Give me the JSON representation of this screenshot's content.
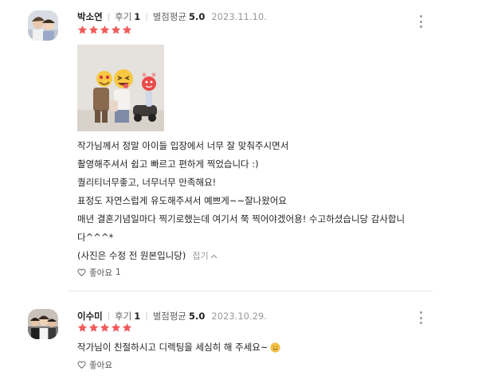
{
  "reviews": [
    {
      "name": "박소연",
      "reviews_label": "후기",
      "reviews_count": "1",
      "avg_label": "별점평균",
      "avg_value": "5.0",
      "date": "2023.11.10.",
      "rating": 5,
      "lines": [
        "작가님께서 정말 아이들 입장에서 너무 잘 맞춰주시면서",
        "촬영해주셔서 쉽고 빠르고 편하게 찍었습니다 :)",
        "퀄리티너무좋고, 너무너무 만족해요!",
        "표정도 자연스럽게 유도해주셔서 예쁘게~~잘나왔어요",
        "매년 결혼기념일마다 찍기로했는데 여기서 쭉 찍어야겠어용! 수고하셨습니당 감사합니",
        "다^^^*",
        "(사진은 수정 전 원본입니당)"
      ],
      "fold_label": "접기",
      "like_label": "좋아요",
      "like_count": "1"
    },
    {
      "name": "이수미",
      "reviews_label": "후기",
      "reviews_count": "1",
      "avg_label": "별점평균",
      "avg_value": "5.0",
      "date": "2023.10.29.",
      "rating": 5,
      "text": "작가님이 친절하시고 디렉팅을 세심히 해 주세요~",
      "like_label": "좋아요"
    }
  ],
  "colors": {
    "star": "#f15c5c",
    "emoji": "#f7c842"
  },
  "icons": [
    "more-vertical-icon",
    "star-icon",
    "heart-outline-icon",
    "chevron-up-icon",
    "smile-emoji-icon"
  ]
}
